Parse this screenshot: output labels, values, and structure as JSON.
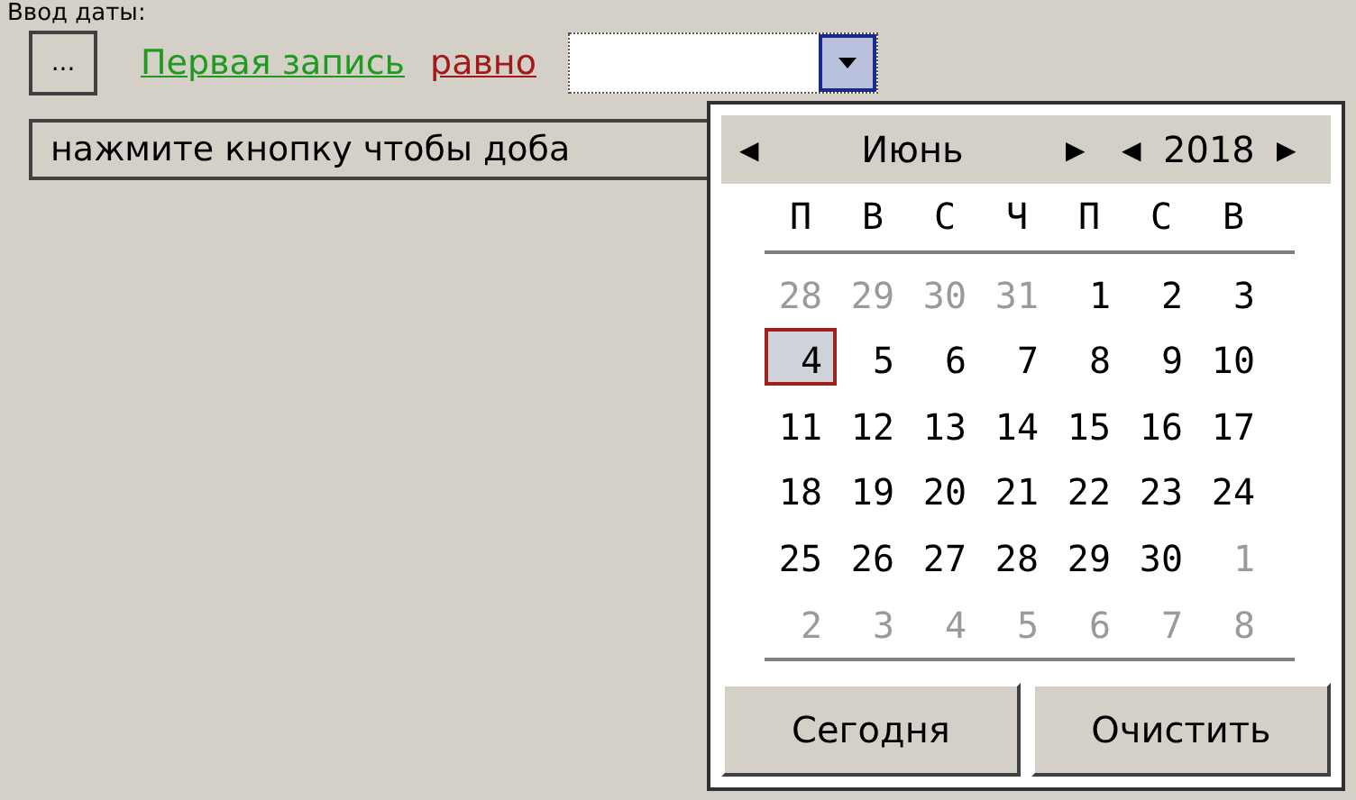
{
  "caption": "Ввод даты:",
  "toolbar": {
    "ellipsis_button": "...",
    "field_link": "Первая запись",
    "operator_link": "равно"
  },
  "hint_field": {
    "value": "нажмите кнопку чтобы доба"
  },
  "calendar": {
    "month": "Июнь",
    "year": "2018",
    "prev_month": "◀",
    "next_month": "▶",
    "prev_year": "◀",
    "next_year": "▶",
    "weekdays": [
      "П",
      "В",
      "С",
      "Ч",
      "П",
      "С",
      "В"
    ],
    "weeks": [
      [
        {
          "day": "28",
          "kind": "other",
          "selected": false
        },
        {
          "day": "29",
          "kind": "other",
          "selected": false
        },
        {
          "day": "30",
          "kind": "other",
          "selected": false
        },
        {
          "day": "31",
          "kind": "other",
          "selected": false
        },
        {
          "day": "1",
          "kind": "current",
          "selected": false
        },
        {
          "day": "2",
          "kind": "current",
          "selected": false
        },
        {
          "day": "3",
          "kind": "current",
          "selected": false
        }
      ],
      [
        {
          "day": "4",
          "kind": "current",
          "selected": true
        },
        {
          "day": "5",
          "kind": "current",
          "selected": false
        },
        {
          "day": "6",
          "kind": "current",
          "selected": false
        },
        {
          "day": "7",
          "kind": "current",
          "selected": false
        },
        {
          "day": "8",
          "kind": "current",
          "selected": false
        },
        {
          "day": "9",
          "kind": "current",
          "selected": false
        },
        {
          "day": "10",
          "kind": "current",
          "selected": false
        }
      ],
      [
        {
          "day": "11",
          "kind": "current",
          "selected": false
        },
        {
          "day": "12",
          "kind": "current",
          "selected": false
        },
        {
          "day": "13",
          "kind": "current",
          "selected": false
        },
        {
          "day": "14",
          "kind": "current",
          "selected": false
        },
        {
          "day": "15",
          "kind": "current",
          "selected": false
        },
        {
          "day": "16",
          "kind": "current",
          "selected": false
        },
        {
          "day": "17",
          "kind": "current",
          "selected": false
        }
      ],
      [
        {
          "day": "18",
          "kind": "current",
          "selected": false
        },
        {
          "day": "19",
          "kind": "current",
          "selected": false
        },
        {
          "day": "20",
          "kind": "current",
          "selected": false
        },
        {
          "day": "21",
          "kind": "current",
          "selected": false
        },
        {
          "day": "22",
          "kind": "current",
          "selected": false
        },
        {
          "day": "23",
          "kind": "current",
          "selected": false
        },
        {
          "day": "24",
          "kind": "current",
          "selected": false
        }
      ],
      [
        {
          "day": "25",
          "kind": "current",
          "selected": false
        },
        {
          "day": "26",
          "kind": "current",
          "selected": false
        },
        {
          "day": "27",
          "kind": "current",
          "selected": false
        },
        {
          "day": "28",
          "kind": "current",
          "selected": false
        },
        {
          "day": "29",
          "kind": "current",
          "selected": false
        },
        {
          "day": "30",
          "kind": "current",
          "selected": false
        },
        {
          "day": "1",
          "kind": "other",
          "selected": false
        }
      ],
      [
        {
          "day": "2",
          "kind": "other",
          "selected": false
        },
        {
          "day": "3",
          "kind": "other",
          "selected": false
        },
        {
          "day": "4",
          "kind": "other",
          "selected": false
        },
        {
          "day": "5",
          "kind": "other",
          "selected": false
        },
        {
          "day": "6",
          "kind": "other",
          "selected": false
        },
        {
          "day": "7",
          "kind": "other",
          "selected": false
        },
        {
          "day": "8",
          "kind": "other",
          "selected": false
        }
      ]
    ],
    "buttons": [
      "Сегодня",
      "Очистить"
    ]
  }
}
